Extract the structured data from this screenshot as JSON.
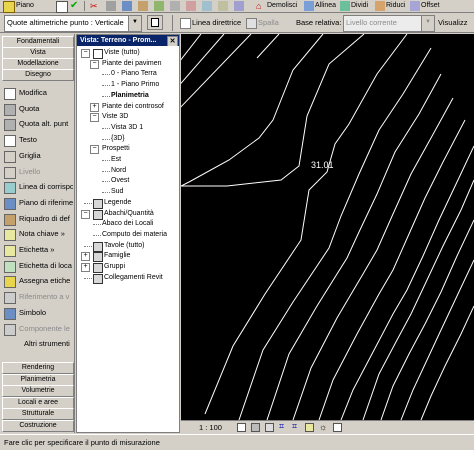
{
  "toolbar": {
    "item1": "Piano",
    "item_demolisci": "Demolisci",
    "item_allinea": "Allinea",
    "item_dividi": "Dividi",
    "item_riduci": "Riduci",
    "item_offset": "Offset"
  },
  "options": {
    "quote_combo": "Quote altimetriche punto : Verticale",
    "linea_direttrice": "Linea direttrice",
    "linea_direttrice_checked": false,
    "spalla": "Spalla",
    "spalla_checked": false,
    "base_relativa_label": "Base relativa:",
    "base_relativa_value": "Livello corrente",
    "visualizza": "Visualizz"
  },
  "design_bar": {
    "top_tabs": [
      "Fondamentali",
      "Vista",
      "Modellazione",
      "Disegno"
    ],
    "tools": [
      {
        "label": "Modifica",
        "icon": "cursor-arrow-icon",
        "enabled": true
      },
      {
        "label": "Quota",
        "icon": "dimension-icon",
        "enabled": true
      },
      {
        "label": "Quota alt. punt",
        "icon": "spot-elevation-icon",
        "enabled": true
      },
      {
        "label": "Testo",
        "icon": "text-tool-icon",
        "enabled": true
      },
      {
        "label": "Griglia",
        "icon": "grid-tool-icon",
        "enabled": true
      },
      {
        "label": "Livello",
        "icon": "level-tool-icon",
        "enabled": false
      },
      {
        "label": "Linea di corrispo",
        "icon": "matchline-icon",
        "enabled": true
      },
      {
        "label": "Piano di riferime",
        "icon": "ref-plane-icon",
        "enabled": true
      },
      {
        "label": "Riquadro di def",
        "icon": "scope-box-icon",
        "enabled": true
      },
      {
        "label": "Nota chiave »",
        "icon": "keynote-icon",
        "enabled": true
      },
      {
        "label": "Etichetta »",
        "icon": "tag-icon",
        "enabled": true
      },
      {
        "label": "Etichetta di loca",
        "icon": "room-tag-icon",
        "enabled": true
      },
      {
        "label": "Assegna etiche",
        "icon": "tag-all-icon",
        "enabled": true
      },
      {
        "label": "Riferimento a v",
        "icon": "view-reference-icon",
        "enabled": false
      },
      {
        "label": "Simbolo",
        "icon": "symbol-icon",
        "enabled": true
      },
      {
        "label": "Componente le",
        "icon": "component-icon",
        "enabled": false
      },
      {
        "label": "Altri strumenti",
        "icon": "",
        "enabled": true
      }
    ],
    "bottom_tabs": [
      "Rendering",
      "Planimetria",
      "Volumetrie",
      "Locali e aree",
      "Strutturale",
      "Costruzione"
    ]
  },
  "browser": {
    "title": "Vista: Terreno - Prom...",
    "nodes": [
      {
        "label": "Viste (tutto)",
        "level": 0,
        "expander": "-",
        "icon": "eyeglasses-icon",
        "bold": false
      },
      {
        "label": "Piante dei pavimen",
        "level": 1,
        "expander": "-",
        "bold": false
      },
      {
        "label": "0 - Piano Terra",
        "level": 2,
        "expander": "",
        "bold": false
      },
      {
        "label": "1 - Piano Primo",
        "level": 2,
        "expander": "",
        "bold": false
      },
      {
        "label": "Planimetria",
        "level": 2,
        "expander": "",
        "bold": true
      },
      {
        "label": "Piante dei controsof",
        "level": 1,
        "expander": "+",
        "bold": false
      },
      {
        "label": "Viste 3D",
        "level": 1,
        "expander": "-",
        "bold": false
      },
      {
        "label": "Vista 3D 1",
        "level": 2,
        "expander": "",
        "bold": false
      },
      {
        "label": "{3D}",
        "level": 2,
        "expander": "",
        "bold": false
      },
      {
        "label": "Prospetti",
        "level": 1,
        "expander": "-",
        "bold": false
      },
      {
        "label": "Est",
        "level": 2,
        "expander": "",
        "bold": false
      },
      {
        "label": "Nord",
        "level": 2,
        "expander": "",
        "bold": false
      },
      {
        "label": "Ovest",
        "level": 2,
        "expander": "",
        "bold": false
      },
      {
        "label": "Sud",
        "level": 2,
        "expander": "",
        "bold": false
      },
      {
        "label": "Legende",
        "level": 0,
        "expander": "",
        "icon": "legend-icon",
        "bold": false
      },
      {
        "label": "Abachi/Quantità",
        "level": 0,
        "expander": "-",
        "icon": "schedule-icon",
        "bold": false
      },
      {
        "label": "Abaco dei Locali",
        "level": 1,
        "expander": "",
        "bold": false
      },
      {
        "label": "Computo dei materia",
        "level": 1,
        "expander": "",
        "bold": false
      },
      {
        "label": "Tavole (tutto)",
        "level": 0,
        "expander": "",
        "icon": "sheet-icon",
        "bold": false
      },
      {
        "label": "Famiglie",
        "level": 0,
        "expander": "+",
        "icon": "family-icon",
        "bold": false
      },
      {
        "label": "Gruppi",
        "level": 0,
        "expander": "+",
        "icon": "group-icon",
        "bold": false
      },
      {
        "label": "Collegamenti Revit",
        "level": 0,
        "expander": "",
        "icon": "link-icon",
        "bold": false
      }
    ]
  },
  "canvas": {
    "elevation_label": "31.01",
    "background": "#000000",
    "line_color": "#ffffff"
  },
  "view_bar": {
    "scale": "1 : 100"
  },
  "status": {
    "text": "Fare clic per specificare il punto di misurazione"
  },
  "colors": {
    "chrome": "#d4d0c8",
    "browser_title": "#0a246a"
  }
}
